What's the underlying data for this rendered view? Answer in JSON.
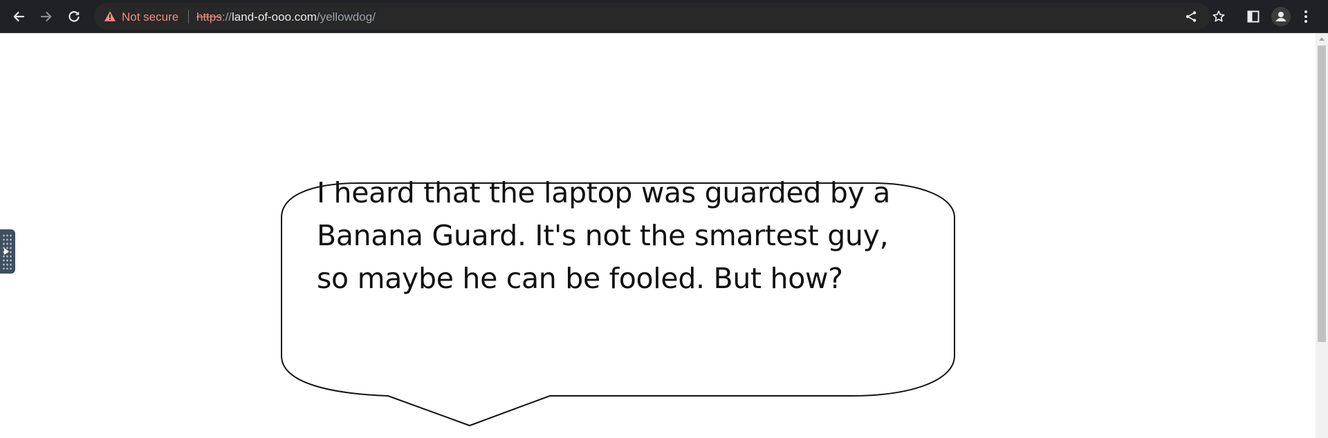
{
  "browser": {
    "security_label": "Not secure",
    "url": {
      "scheme": "https",
      "separator": "://",
      "host": "land-of-ooo.com",
      "path": "/yellowdog/"
    },
    "icons": {
      "back": "arrow-left-icon",
      "forward": "arrow-right-icon",
      "reload": "reload-icon",
      "warning": "warning-triangle-icon",
      "share": "share-icon",
      "bookmark": "star-icon",
      "side_panel": "side-panel-icon",
      "profile": "profile-icon",
      "menu": "kebab-menu-icon"
    }
  },
  "page": {
    "speech_bubble": {
      "text": "I heard that the laptop was guarded by a Banana Guard. It's not the smartest guy, so maybe he can be fooled. But how?"
    }
  },
  "colors": {
    "toolbar_bg": "#202124",
    "warning": "#f28b82",
    "page_bg": "#ffffff"
  }
}
